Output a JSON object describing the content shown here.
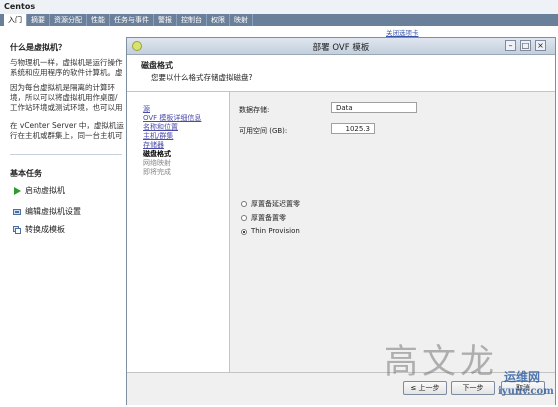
{
  "app": {
    "title": "Centos"
  },
  "tabs": [
    "入门",
    "摘要",
    "资源分配",
    "性能",
    "任务与事件",
    "警报",
    "控制台",
    "权限",
    "映射"
  ],
  "left_panel": {
    "heading": "什么是虚拟机？",
    "para1": "与物理机一样，虚拟机是运行操作系统和应用程序的软件计算机。虚拟机上安装的操作系统称为",
    "para2": "因为每台虚拟机是隔离的计算环境，所以可以将虚拟机用作桌面/工作站环境或测试环境，也可以用来整合服务器应用程序。",
    "para3": "在 vCenter Server 中，虚拟机运行在主机或群集上，同一台主机可运行多个虚拟机。",
    "tasks_heading": "基本任务",
    "tasks": [
      "启动虚拟机",
      "编辑虚拟机设置",
      "转换成模板"
    ],
    "close_tab_link": "关闭选项卡"
  },
  "dialog": {
    "title": "部署 OVF 模板",
    "header_title": "磁盘格式",
    "header_subtitle": "您要以什么格式存储虚拟磁盘?",
    "nav": [
      {
        "label": "源",
        "state": "link"
      },
      {
        "label": "OVF 模板详细信息",
        "state": "link"
      },
      {
        "label": "名称和位置",
        "state": "link"
      },
      {
        "label": "主机/群集",
        "state": "link"
      },
      {
        "label": "存储器",
        "state": "link"
      },
      {
        "label": "磁盘格式",
        "state": "current"
      },
      {
        "label": "网络映射",
        "state": "disabled"
      },
      {
        "label": "即将完成",
        "state": "disabled"
      }
    ],
    "datastore_label": "数据存储:",
    "datastore_value": "Data",
    "free_space_label": "可用空间 (GB):",
    "free_space_value": "1025.3",
    "options": [
      {
        "label": "厚置备延迟置零",
        "selected": false
      },
      {
        "label": "厚置备置零",
        "selected": false
      },
      {
        "label": "Thin Provision",
        "selected": true
      }
    ],
    "buttons": {
      "back": "≤ 上一步",
      "next": "下一步",
      "cancel": "取消"
    }
  },
  "watermark": {
    "text1": "高文龙",
    "text2": "运维网",
    "url": "iyunv.com"
  }
}
